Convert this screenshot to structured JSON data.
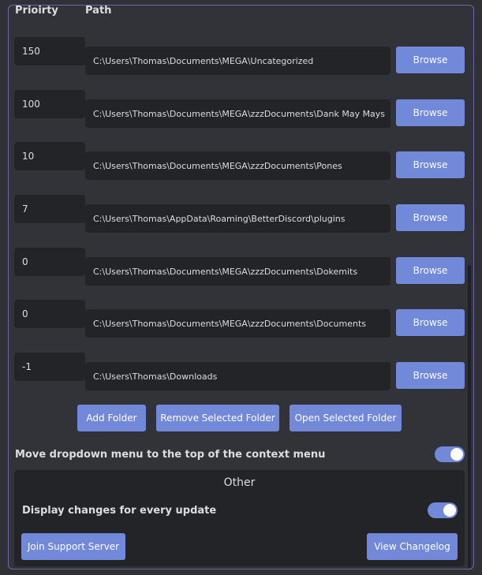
{
  "headers": {
    "priority": "Prioirty",
    "path": "Path"
  },
  "folders": [
    {
      "priority": "150",
      "path": "C:\\Users\\Thomas\\Documents\\MEGA\\Uncategorized",
      "browse": "Browse"
    },
    {
      "priority": "100",
      "path": "C:\\Users\\Thomas\\Documents\\MEGA\\zzzDocuments\\Dank May Mays",
      "browse": "Browse"
    },
    {
      "priority": "10",
      "path": "C:\\Users\\Thomas\\Documents\\MEGA\\zzzDocuments\\Pones",
      "browse": "Browse"
    },
    {
      "priority": "7",
      "path": "C:\\Users\\Thomas\\AppData\\Roaming\\BetterDiscord\\plugins",
      "browse": "Browse"
    },
    {
      "priority": "0",
      "path": "C:\\Users\\Thomas\\Documents\\MEGA\\zzzDocuments\\Dokemits",
      "browse": "Browse"
    },
    {
      "priority": "0",
      "path": "C:\\Users\\Thomas\\Documents\\MEGA\\zzzDocuments\\Documents",
      "browse": "Browse"
    },
    {
      "priority": "-1",
      "path": "C:\\Users\\Thomas\\Downloads",
      "browse": "Browse"
    }
  ],
  "actions": {
    "add_folder": "Add Folder",
    "remove_selected": "Remove Selected Folder",
    "open_selected": "Open Selected Folder"
  },
  "settings": {
    "move_dropdown_label": "Move dropdown menu to the top of the context menu",
    "move_dropdown_enabled": true
  },
  "other": {
    "title": "Other",
    "display_changes_label": "Display changes for every update",
    "display_changes_enabled": true,
    "join_support": "Join Support Server",
    "view_changelog": "View Changelog"
  },
  "colors": {
    "background": "#313338",
    "input_bg": "#232428",
    "accent": "#7289da",
    "text": "#dcddde",
    "frame_border": "#6a68a8"
  }
}
